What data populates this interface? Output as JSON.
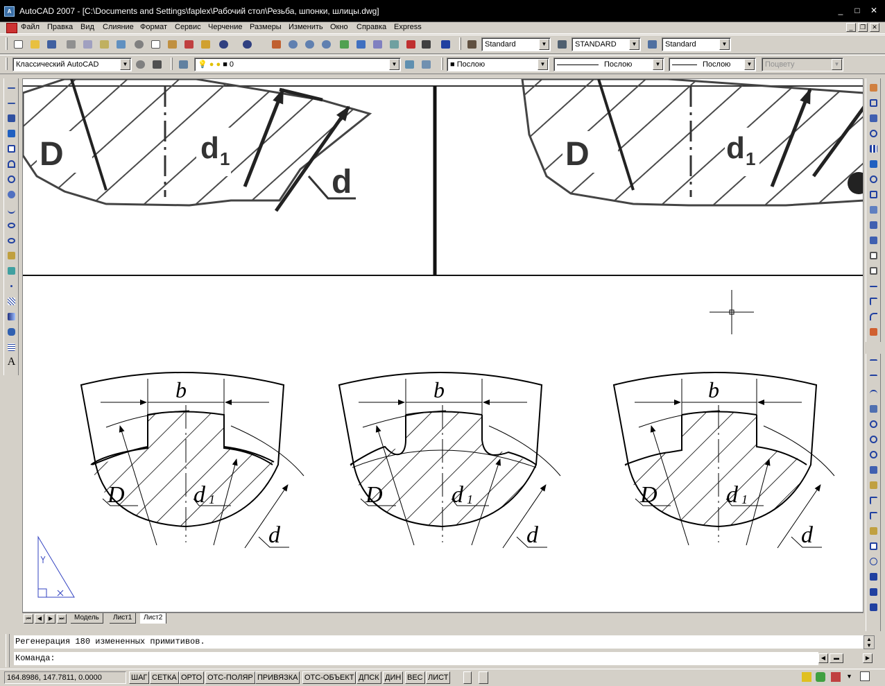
{
  "window": {
    "title": "AutoCAD 2007 - [C:\\Documents and Settings\\faplex\\Рабочий стол\\Резьба, шпонки, шлицы.dwg]",
    "controls": [
      "_",
      "□",
      "✕"
    ]
  },
  "menu": {
    "items": [
      "Файл",
      "Правка",
      "Вид",
      "Слияние",
      "Формат",
      "Сервис",
      "Черчение",
      "Размеры",
      "Изменить",
      "Окно",
      "Справка",
      "Express"
    ]
  },
  "toolbar1": {
    "text_style": "Standard",
    "dim_style": "STANDARD",
    "table_style": "Standard"
  },
  "toolbar2": {
    "workspace": "Классический AutoCAD",
    "layer": "0",
    "color": "Послою",
    "linetype": "Послою",
    "lineweight": "Послою",
    "plotstyle": "Поцвету"
  },
  "drawing": {
    "labels": {
      "b": "b",
      "D": "D",
      "d1_base": "d",
      "d1_sub": "1",
      "d": "d"
    }
  },
  "tabs": {
    "items": [
      "Модель",
      "Лист1",
      "Лист2"
    ],
    "active": "Лист2"
  },
  "command": {
    "history": "Регенерация 180 измененных примитивов.",
    "prompt": "Команда:"
  },
  "status": {
    "coords": "164.8986, 147.7811, 0.0000",
    "buttons": [
      "ШАГ",
      "СЕТКА",
      "ОРТО",
      "ОТС-ПОЛЯР",
      "ПРИВЯЗКА",
      "ОТС-ОБЪЕКТ",
      "ДПСК",
      "ДИН",
      "ВЕС",
      "ЛИСТ"
    ]
  },
  "colors": {
    "titlebar_bg": "#000000",
    "ui_face": "#d4d0c8",
    "canvas_bg": "#ffffff",
    "hatch": "#000000"
  }
}
